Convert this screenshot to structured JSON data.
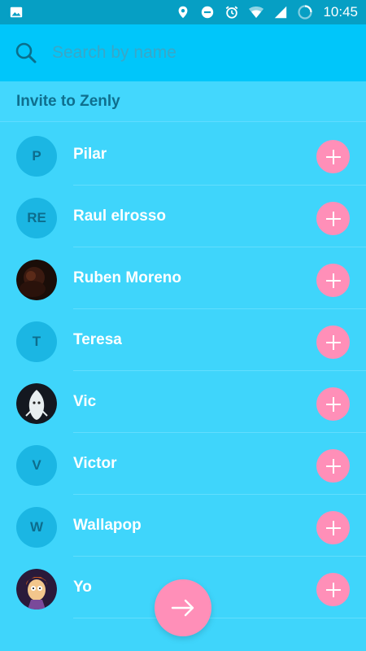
{
  "status_bar": {
    "time": "10:45",
    "icons": [
      "image-icon",
      "location-icon",
      "do-not-disturb-icon",
      "alarm-icon",
      "wifi-icon",
      "signal-icon",
      "battery-icon"
    ]
  },
  "search": {
    "placeholder": "Search by name"
  },
  "section": {
    "title": "Invite to Zenly"
  },
  "contacts": [
    {
      "name": "Pilar",
      "initials": "P"
    },
    {
      "name": "Raul elrosso",
      "initials": "RE"
    },
    {
      "name": "Ruben Moreno",
      "initials": ""
    },
    {
      "name": "Teresa",
      "initials": "T"
    },
    {
      "name": "Vic",
      "initials": ""
    },
    {
      "name": "Victor",
      "initials": "V"
    },
    {
      "name": "Wallapop",
      "initials": "W"
    },
    {
      "name": "Yo",
      "initials": ""
    }
  ],
  "colors": {
    "background": "#3fd5fb",
    "status_bar": "#069fc4",
    "search_header": "#00c6fa",
    "accent_pink": "#ff8fb8",
    "avatar_bg": "#1bb6e3",
    "section_title": "#0f6f8e"
  },
  "fab": {
    "icon": "arrow-right-icon"
  }
}
